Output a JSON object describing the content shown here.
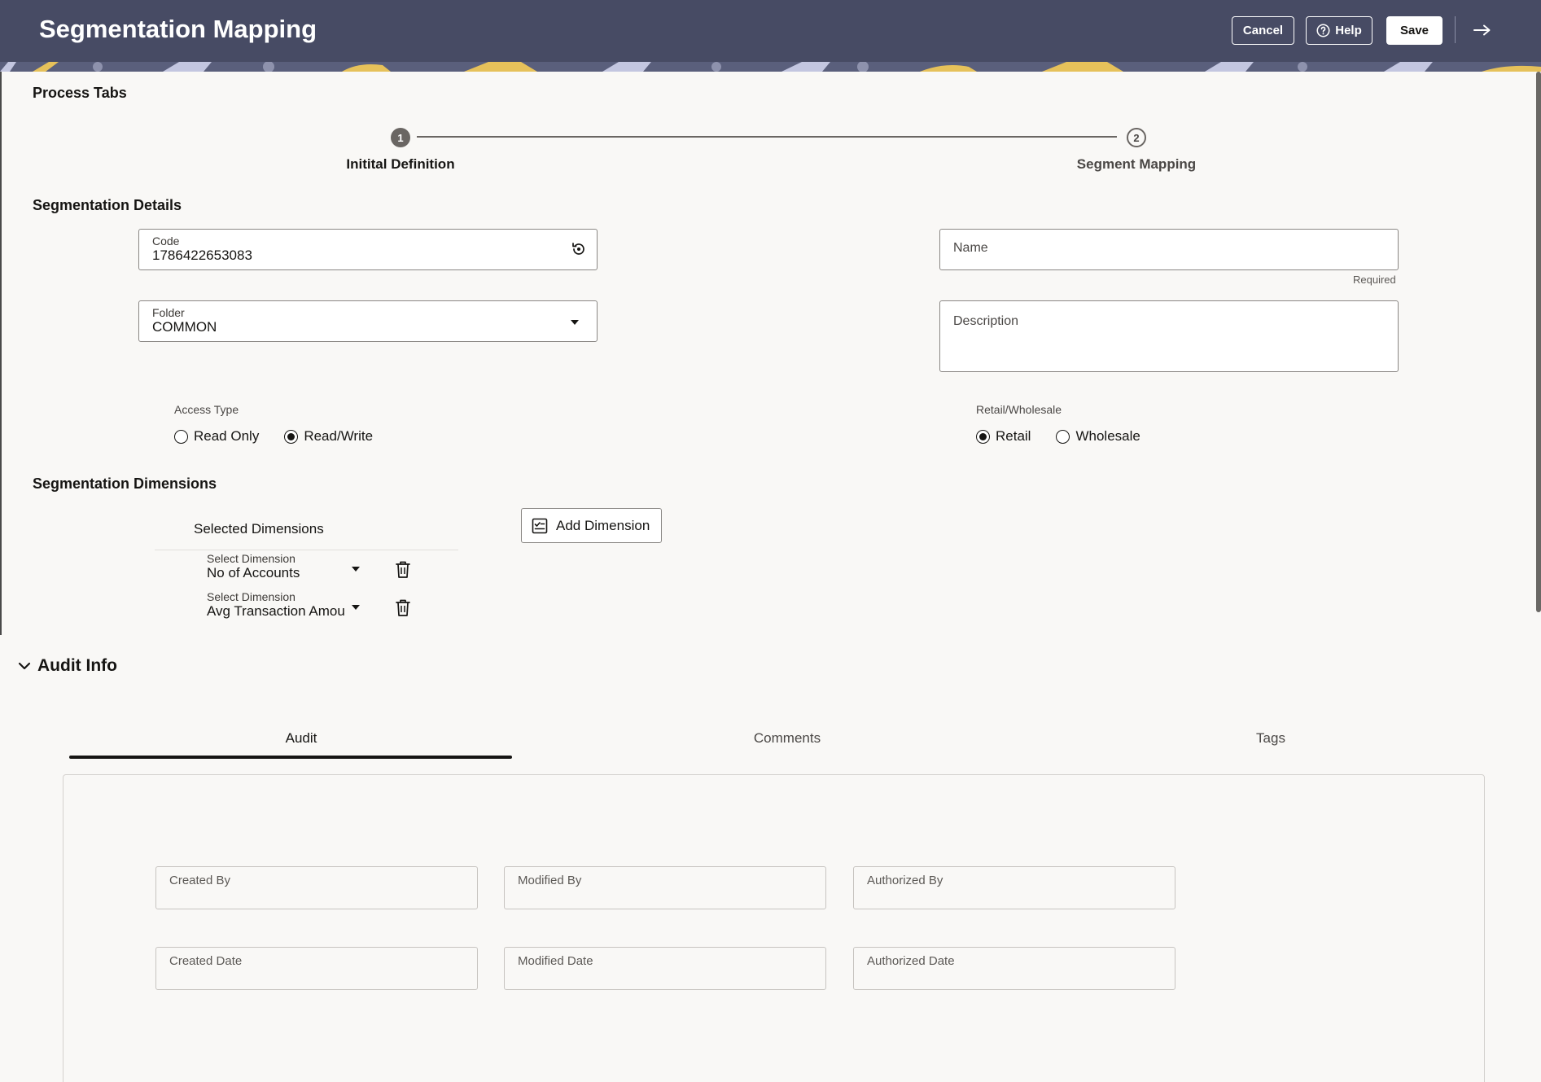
{
  "header": {
    "title": "Segmentation Mapping",
    "cancel_label": "Cancel",
    "help_label": "Help",
    "save_label": "Save"
  },
  "process_tabs": {
    "title": "Process Tabs",
    "steps": [
      {
        "number": "1",
        "label": "Initital Definition",
        "active": true
      },
      {
        "number": "2",
        "label": "Segment Mapping",
        "active": false
      }
    ]
  },
  "segmentation_details": {
    "title": "Segmentation Details",
    "code": {
      "label": "Code",
      "value": "1786422653083"
    },
    "folder": {
      "label": "Folder",
      "value": "COMMON"
    },
    "name": {
      "placeholder": "Name",
      "helper": "Required"
    },
    "description": {
      "placeholder": "Description"
    },
    "access_type": {
      "label": "Access Type",
      "options": [
        "Read Only",
        "Read/Write"
      ],
      "selected": "Read/Write"
    },
    "retail_wholesale": {
      "label": "Retail/Wholesale",
      "options": [
        "Retail",
        "Wholesale"
      ],
      "selected": "Retail"
    }
  },
  "segmentation_dimensions": {
    "title": "Segmentation Dimensions",
    "selected_header": "Selected Dimensions",
    "add_label": "Add Dimension",
    "rows": [
      {
        "label": "Select Dimension",
        "value": "No of Accounts"
      },
      {
        "label": "Select Dimension",
        "value": "Avg Transaction Amou"
      }
    ]
  },
  "audit_info": {
    "title": "Audit Info",
    "tabs": [
      "Audit",
      "Comments",
      "Tags"
    ],
    "active_tab": "Audit",
    "fields": {
      "created_by": "Created By",
      "modified_by": "Modified By",
      "authorized_by": "Authorized By",
      "created_date": "Created Date",
      "modified_date": "Modified Date",
      "authorized_date": "Authorized Date"
    }
  },
  "colors": {
    "header_bg": "#474b64",
    "page_bg": "#f9f8f6",
    "accent_yellow": "#e6c15a"
  },
  "icons": [
    "help-circle-icon",
    "exit-arrow-icon",
    "refresh-icon",
    "chevron-down-icon",
    "checklist-icon",
    "trash-icon",
    "collapse-chevron-icon"
  ]
}
